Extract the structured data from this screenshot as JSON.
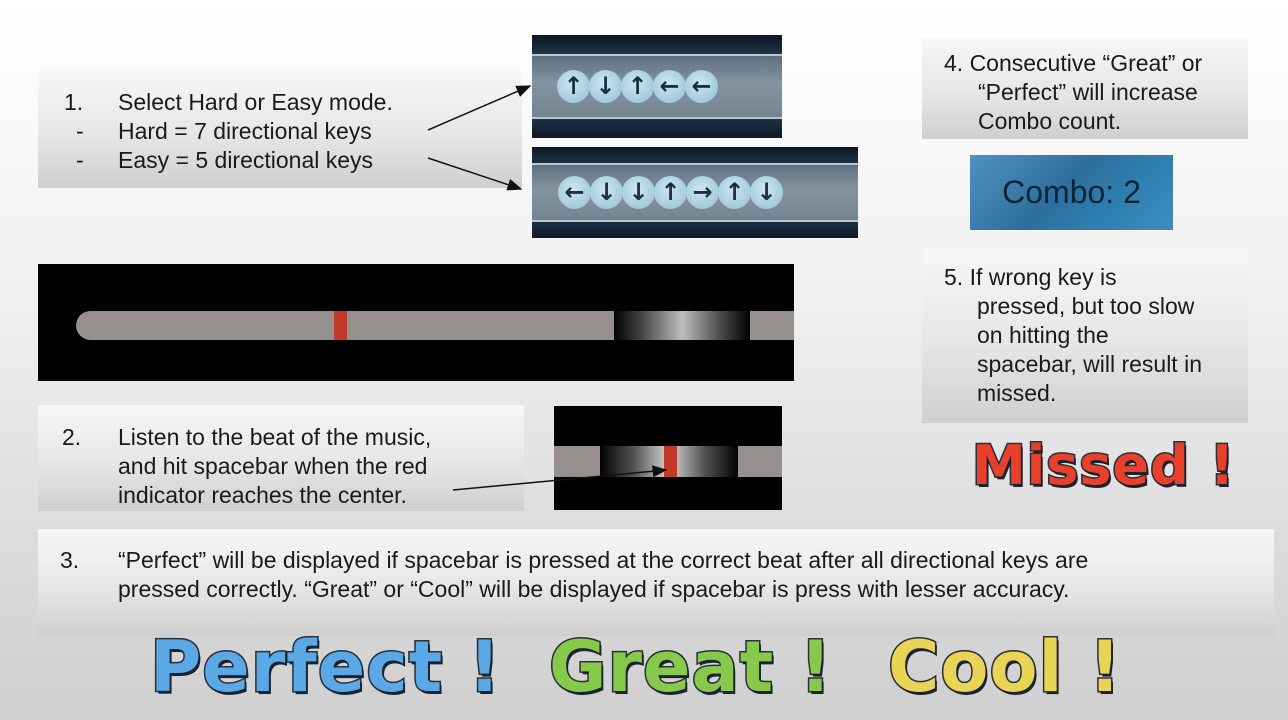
{
  "step1": {
    "number": "1.",
    "text": "Select Hard or Easy mode.",
    "bullet": "-",
    "hard": "Hard = 7 directional keys",
    "easy": "Easy = 5 directional keys"
  },
  "hard_keys": [
    "↑",
    "↓",
    "↑",
    "←",
    "←"
  ],
  "easy_keys": [
    "←",
    "↓",
    "↓",
    "↑",
    "→",
    "↑",
    "↓"
  ],
  "rhythm_bar": {
    "indicator_color": "#c0392b",
    "track_color": "#958f8e"
  },
  "step2": {
    "number": "2.",
    "line1": "Listen to the beat of the music,",
    "line2": "and hit spacebar when the red",
    "line3": "indicator reaches the center."
  },
  "step3": {
    "number": "3.",
    "line1": "“Perfect” will be displayed if spacebar is pressed at the correct beat after all directional keys are",
    "line2": "pressed correctly. “Great” or “Cool” will be displayed if spacebar is press with lesser accuracy."
  },
  "step4": {
    "line1": "4. Consecutive “Great” or",
    "line2": "“Perfect” will increase",
    "line3": "Combo count."
  },
  "combo": "Combo: 2",
  "step5": {
    "line1": "5. If wrong key is",
    "line2": "pressed, but too slow",
    "line3": "on hitting the",
    "line4": "spacebar, will result in",
    "line5": "missed."
  },
  "results": {
    "missed": "Missed !",
    "perfect": "Perfect !",
    "great": "Great !",
    "cool": "Cool !"
  }
}
